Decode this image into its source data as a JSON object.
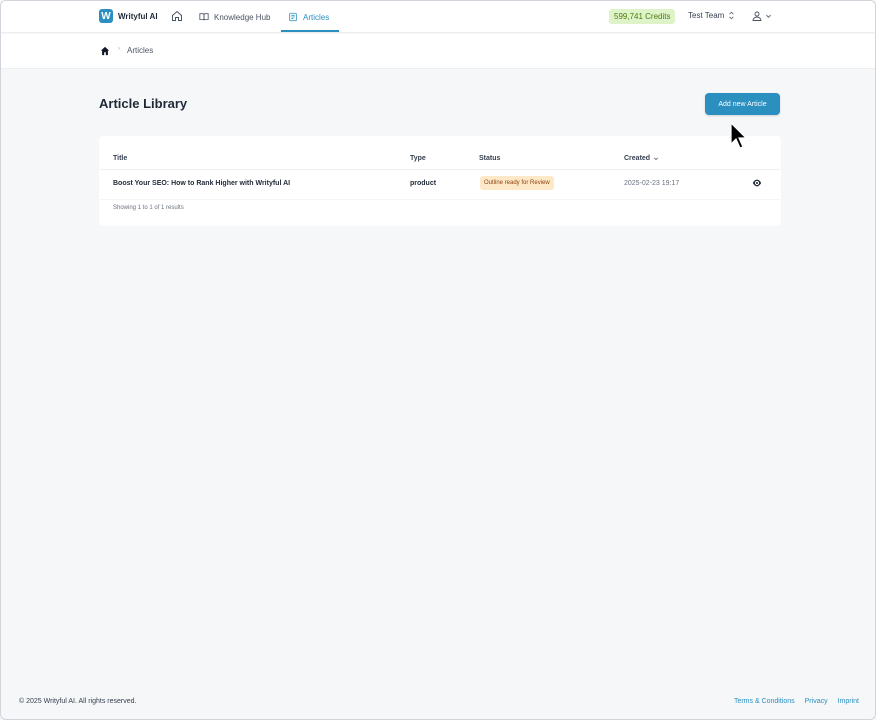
{
  "app": {
    "brand_logo_letter": "W",
    "brand_name": "Writyful AI",
    "accent_color": "#2b8fc0"
  },
  "nav": {
    "items": [
      {
        "label": "Knowledge Hub",
        "icon": "book-icon"
      },
      {
        "label": "Articles",
        "icon": "document-icon",
        "active": true
      }
    ],
    "home_icon": "home-icon",
    "credits": "599,741 Credits",
    "team": "Test Team",
    "user_icon": "user-icon"
  },
  "breadcrumb": {
    "current": "Articles",
    "home_icon": "home-icon"
  },
  "page": {
    "title": "Article Library",
    "add_button": "Add new Article"
  },
  "table": {
    "headers": {
      "title": "Title",
      "type": "Type",
      "status": "Status",
      "created": "Created"
    },
    "rows": [
      {
        "title": "Boost Your SEO: How to Rank Higher with Writyful AI",
        "type": "product",
        "status": "Outline ready for Review",
        "created": "2025-02-23 19:17",
        "action_icon": "eye-icon"
      }
    ],
    "results_text": "Showing 1 to 1 of 1 results"
  },
  "footer": {
    "copyright": "© 2025 Writyful AI. All rights reserved.",
    "links": [
      "Terms & Conditions",
      "Privacy",
      "Imprint"
    ]
  }
}
